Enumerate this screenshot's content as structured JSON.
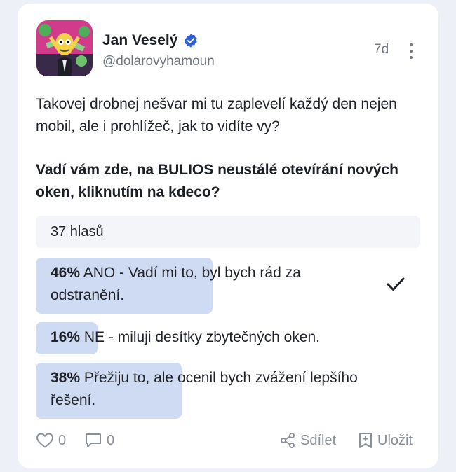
{
  "post": {
    "author_name": "Jan Veselý",
    "author_handle": "@dolarovyhamoun",
    "time_ago": "7d",
    "text": "Takovej drobnej nešvar mi tu zaplevelí každý den nejen mobil, ale i prohlížeč, jak to vidíte vy?"
  },
  "poll": {
    "question": "Vadí vám zde, na BULIOS neustálé otevírání nových oken, kliknutím na kdeco?",
    "votes_label": "37 hlasů",
    "options": [
      {
        "percent_label": "46%",
        "text": "ANO - Vadí mi to, byl bych rád za odstranění.",
        "fraction": 0.46,
        "selected": true
      },
      {
        "percent_label": "16%",
        "text": "NE - miluji desítky zbytečných oken.",
        "fraction": 0.16,
        "selected": false
      },
      {
        "percent_label": "38%",
        "text": "Přežiju to, ale ocenil bych zvážení lepšího řešení.",
        "fraction": 0.38,
        "selected": false
      }
    ]
  },
  "actions": {
    "likes": "0",
    "comments": "0",
    "share_label": "Sdílet",
    "save_label": "Uložit"
  },
  "icons": {
    "verified": "verified-badge-icon",
    "more": "more-vertical-icon",
    "check": "check-icon",
    "like": "heart-icon",
    "comment": "comment-icon",
    "share": "share-icon",
    "save": "bookmark-add-icon"
  },
  "colors": {
    "accent": "#2f5fd6",
    "poll_fill": "#cfdaf3",
    "muted": "#8a9099"
  }
}
